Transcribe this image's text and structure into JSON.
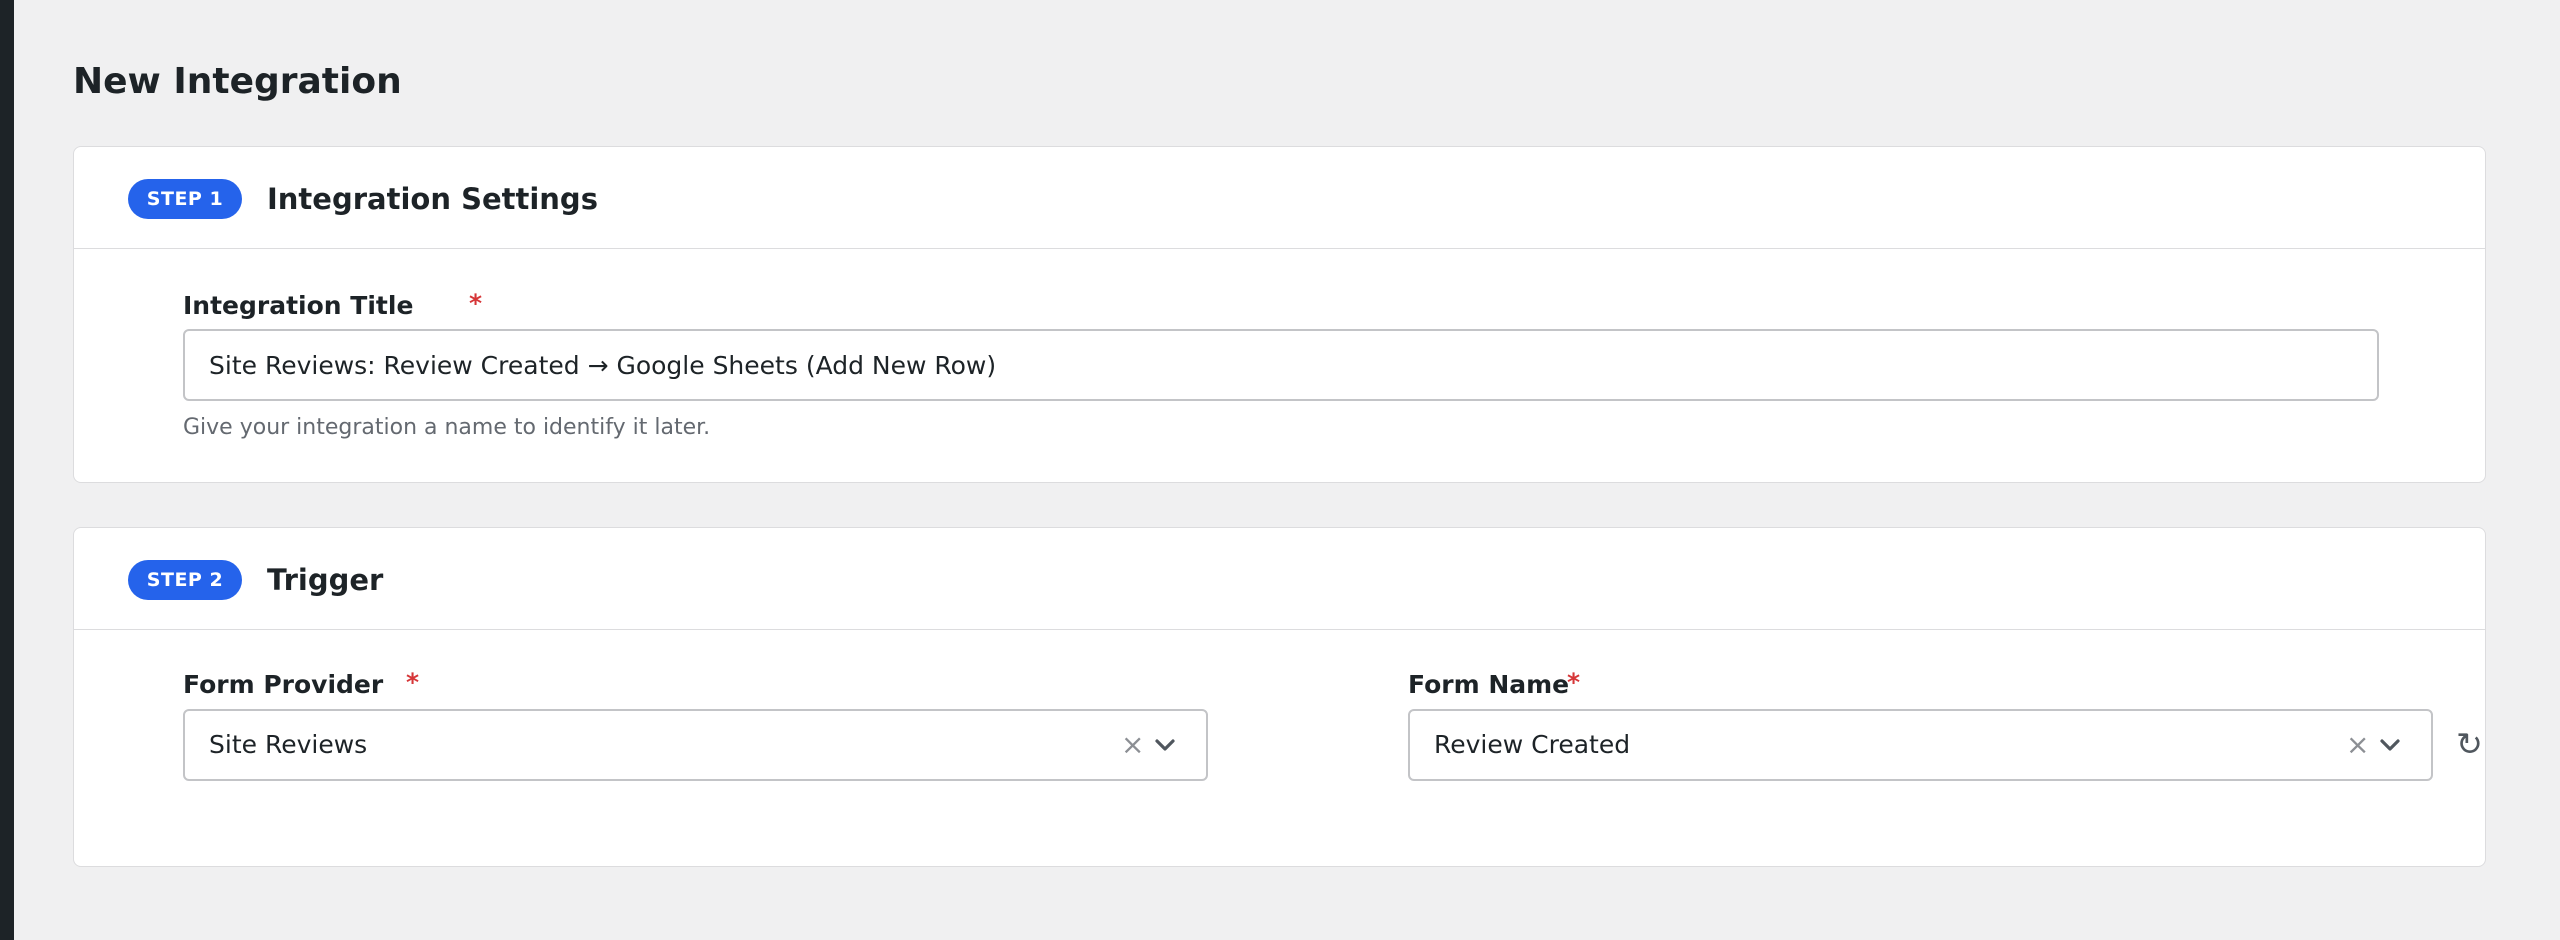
{
  "page": {
    "title": "New Integration"
  },
  "step1": {
    "badge": "STEP 1",
    "title": "Integration Settings",
    "integration_title": {
      "label": "Integration Title",
      "required_mark": "*",
      "value": "Site Reviews: Review Created → Google Sheets (Add New Row)",
      "help": "Give your integration a name to identify it later."
    }
  },
  "step2": {
    "badge": "STEP 2",
    "title": "Trigger",
    "form_provider": {
      "label": "Form Provider",
      "required_mark": "*",
      "value": "Site Reviews",
      "clear_glyph": "×"
    },
    "form_name": {
      "label": "Form Name",
      "required_mark": "*",
      "value": "Review Created",
      "clear_glyph": "×"
    },
    "refresh_glyph": "↻"
  },
  "icons": {
    "clear": "close-icon",
    "dropdown": "chevron-down-icon",
    "refresh": "refresh-icon"
  },
  "colors": {
    "accent": "#2563eb",
    "required": "#d63638",
    "background": "#f0f0f1",
    "text": "#1d2327"
  }
}
